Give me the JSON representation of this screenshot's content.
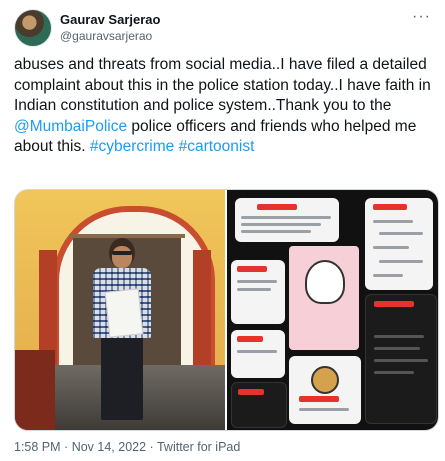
{
  "tweet": {
    "author": {
      "display_name": "Gaurav Sarjerao",
      "handle": "@gauravsarjerao",
      "avatar_icon": "avatar-photo"
    },
    "more_icon": "more-horizontal-icon",
    "body": {
      "text_1": "abuses and threats from social media..I have filed a detailed complaint about this in the police station today..I have faith in Indian constitution and police system..Thank you to the ",
      "mention": "@MumbaiPolice",
      "text_2": " police officers and friends who helped me about this.",
      "hashtag_1": "#cybercrime",
      "hashtag_2": "#cartoonist"
    },
    "media": {
      "photo_left": "man-holding-complaint-letter-photo",
      "photo_right": "screenshots-collage-photo"
    },
    "footer": {
      "time": "1:58 PM",
      "separator_1": "·",
      "date": "Nov 14, 2022",
      "separator_2": "·",
      "source": "Twitter for iPad"
    },
    "colors": {
      "link": "#1d9bf0",
      "text": "#0f1419",
      "muted": "#536471"
    }
  }
}
